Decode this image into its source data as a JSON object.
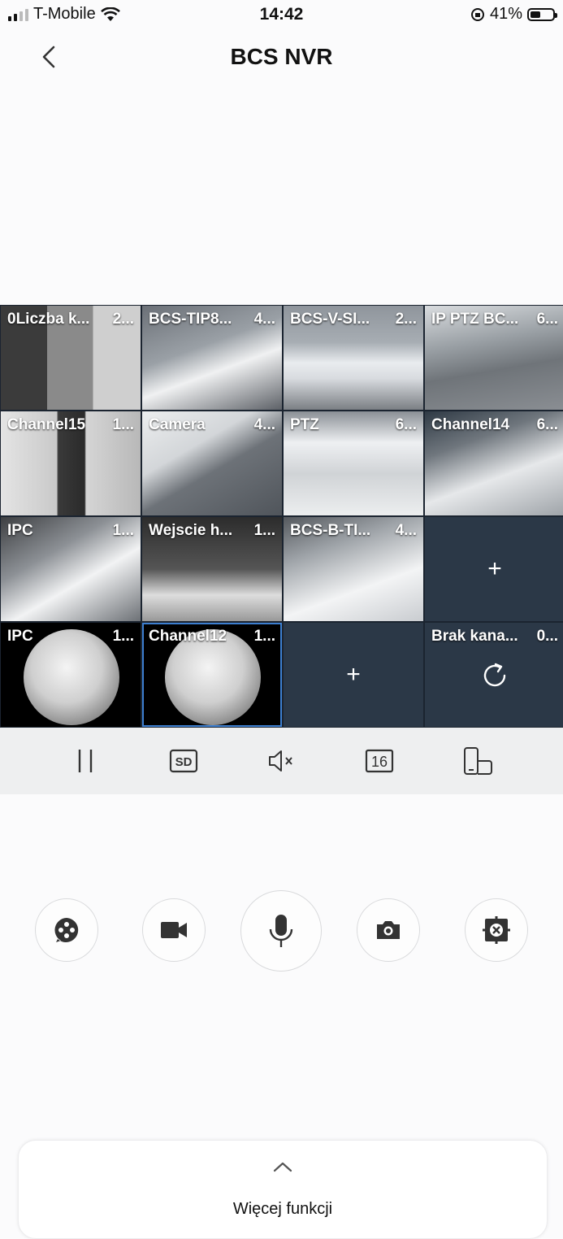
{
  "status_bar": {
    "carrier": "T-Mobile",
    "time": "14:42",
    "battery": "41%"
  },
  "header": {
    "title": "BCS NVR"
  },
  "channels": [
    {
      "name": "0Liczba k...",
      "num": "2..."
    },
    {
      "name": "BCS-TIP8...",
      "num": "4..."
    },
    {
      "name": "BCS-V-SI...",
      "num": "2..."
    },
    {
      "name": "IP PTZ BC...",
      "num": "6..."
    },
    {
      "name": "Channel15",
      "num": "1..."
    },
    {
      "name": "Camera",
      "num": "4..."
    },
    {
      "name": "PTZ",
      "num": "6..."
    },
    {
      "name": "Channel14",
      "num": "6..."
    },
    {
      "name": "IPC",
      "num": "1..."
    },
    {
      "name": "Wejscie h...",
      "num": "1..."
    },
    {
      "name": "BCS-B-TI...",
      "num": "4..."
    },
    {
      "name": "",
      "num": ""
    },
    {
      "name": "IPC",
      "num": "1..."
    },
    {
      "name": "Channel12",
      "num": "1..."
    },
    {
      "name": "",
      "num": ""
    },
    {
      "name": "Brak kana...",
      "num": "0..."
    }
  ],
  "icons": {
    "add": "+",
    "quality": "SD",
    "layout": "16"
  },
  "more_panel": {
    "label": "Więcej funkcji"
  }
}
